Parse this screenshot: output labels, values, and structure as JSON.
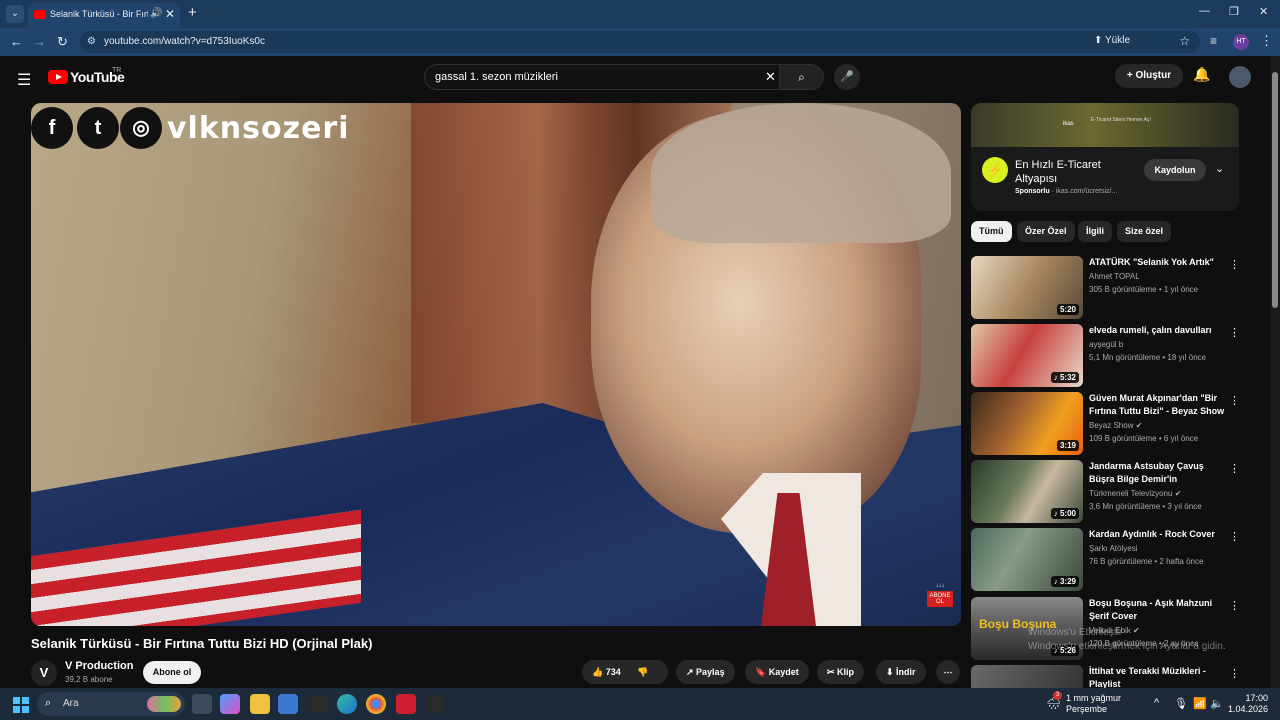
{
  "browser": {
    "tab_title": "Selanik Türküsü - Bir Fırtına",
    "url": "youtube.com/watch?v=d753IuoKs0c",
    "upload_label": "Yükle",
    "profile_initials": "HT"
  },
  "youtube": {
    "logo_text": "YouTube",
    "country": "TR",
    "search_query": "gassal 1. sezon müzikleri",
    "create_label": "Oluştur"
  },
  "video": {
    "overlay_brand": "vlknsozeri",
    "subscribe_badge": "ABONE OL",
    "title": "Selanik Türküsü - Bir Fırtına Tuttu Bizi HD (Orjinal Plak)",
    "channel_initial": "V",
    "channel_name": "V Production",
    "channel_subs": "39,2 B abone",
    "subscribe_label": "Abone ol",
    "likes": "734",
    "share_label": "Paylaş",
    "save_label": "Kaydet",
    "clip_label": "Klip",
    "download_label": "İndir"
  },
  "ad": {
    "banner_brand": "ikas",
    "banner_text": "E-Ticaret Siteni Hemen Aç!",
    "title": "En Hızlı E-Ticaret Altyapısı",
    "sponsor_label": "Sponsorlu",
    "sponsor_url": "ikas.com/ücretsiz/...",
    "cta": "Kaydolun"
  },
  "chips": [
    "Tümü",
    "Özer Özel",
    "İlgili",
    "Size özel"
  ],
  "related": [
    {
      "title": "ATATÜRK \"Selanik Yok Artık\"",
      "channel": "Ahmet TOPAL",
      "meta": "305 B görüntüleme • 1 yıl önce",
      "duration": "5:20",
      "verified": false,
      "music": false
    },
    {
      "title": "elveda rumeli, çalın davulları",
      "channel": "ayşegül b",
      "meta": "5,1 Mn görüntüleme • 18 yıl önce",
      "duration": "5:32",
      "verified": false,
      "music": true
    },
    {
      "title": "Güven Murat Akpınar'dan \"Bir Fırtına Tuttu Bizi\" - Beyaz Show",
      "channel": "Beyaz Show",
      "meta": "109 B görüntüleme • 6 yıl önce",
      "duration": "3:19",
      "verified": true,
      "music": false
    },
    {
      "title": "Jandarma Astsubay Çavuş Büşra Bilge Demir'in büyüleyici...",
      "channel": "Türkmeneli Televizyonu",
      "meta": "3,6 Mn görüntüleme • 3 yıl önce",
      "duration": "5:00",
      "verified": true,
      "music": true
    },
    {
      "title": "Kardan Aydınlık - Rock Cover",
      "channel": "Şarkı Atölyesi",
      "meta": "76 B görüntüleme • 2 hafta önce",
      "duration": "3:29",
      "verified": false,
      "music": true
    },
    {
      "title": "Boşu Boşuna - Aşık Mahzuni Şerif Cover",
      "channel": "Velkıdı Ebik",
      "meta": "120 B görüntüleme • 2 ay önce",
      "duration": "5:26",
      "verified": true,
      "music": true
    },
    {
      "title": "İttihat ve Terakki Müzikleri - Playlist",
      "channel": "",
      "meta": "",
      "duration": "",
      "verified": false,
      "music": false
    }
  ],
  "related_thumb6_text": "Boşu Boşuna",
  "watermark": {
    "line1": "Windows'u Etkinleştir",
    "line2": "Windows'u etkinleştirmek için Ayarlar'a gidin."
  },
  "taskbar": {
    "search_label": "Ara",
    "weather": "1 mm yağmur",
    "weather_day": "Perşembe",
    "weather_badge": "3",
    "time": "17:00",
    "date": "1.04.2026"
  }
}
